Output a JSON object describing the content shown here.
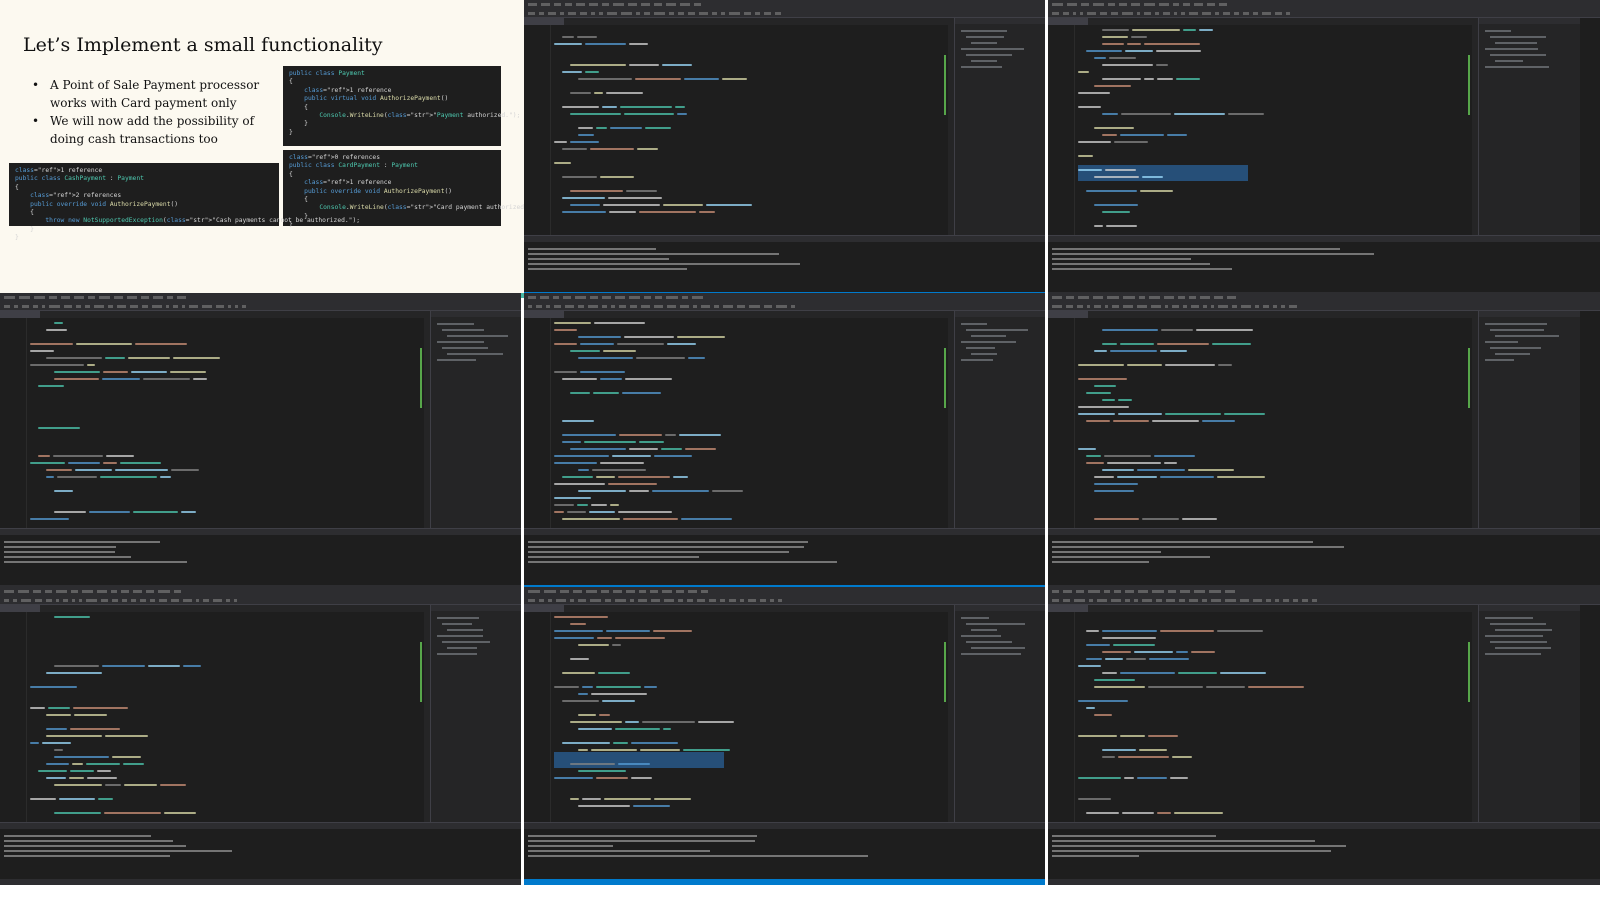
{
  "slide": {
    "title": "Let’s Implement a small functionality",
    "bullets": [
      "A Point of Sale Payment processor works with Card payment only",
      "We will now add the possibility of doing cash transactions too"
    ],
    "code_payment": "public class Payment\n{\n    1 reference\n    public virtual void AuthorizePayment()\n    {\n        Console.WriteLine(\"Payment authorized.\");\n    }\n}",
    "code_card": "0 references\npublic class CardPayment : Payment\n{\n    1 reference\n    public override void AuthorizePayment()\n    {\n        Console.WriteLine(\"Card payment authorized.\");\n    }\n}",
    "code_cash": "1 reference\npublic class CashPayment : Payment\n{\n    2 references\n    public override void AuthorizePayment()\n    {\n        throw new NotSupportedException(\"Cash payments cannot be authorized.\");\n    }\n}"
  },
  "colors": {
    "slide_background": "#fcf9f0",
    "slide_accent_bar": "#47b9a6",
    "ide_background": "#1e1e1e",
    "ide_chrome": "#2d2d30",
    "status_bar": "#007acc",
    "selection": "#264f78"
  },
  "tiles": [
    {
      "kind": "slide"
    },
    {
      "kind": "ide",
      "selection": false
    },
    {
      "kind": "ide",
      "selection": true
    },
    {
      "kind": "ide",
      "selection": false
    },
    {
      "kind": "ide",
      "selection": false
    },
    {
      "kind": "ide",
      "selection": false
    },
    {
      "kind": "ide",
      "selection": false
    },
    {
      "kind": "ide",
      "selection": true
    },
    {
      "kind": "ide",
      "selection": false
    }
  ]
}
